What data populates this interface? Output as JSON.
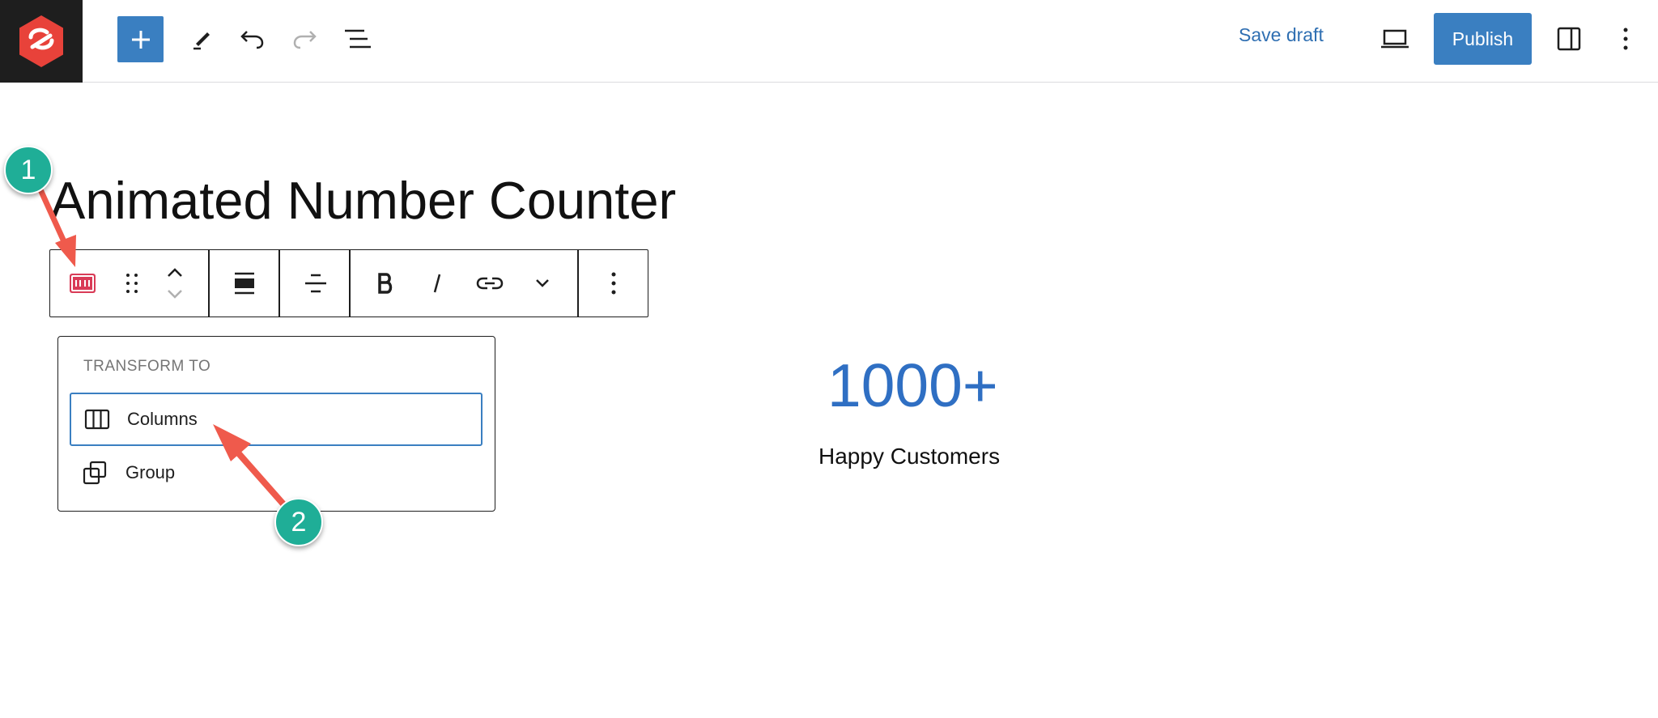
{
  "header": {
    "save_draft_label": "Save draft",
    "publish_label": "Publish",
    "accent_color": "#3a7fc1",
    "logo_color": "#e8423a"
  },
  "editor": {
    "title": "Animated Number Counter"
  },
  "block_toolbar": {
    "icons": [
      "counter-block-icon",
      "drag-handle-icon",
      "move-up-icon",
      "move-down-icon",
      "align-wide-icon",
      "align-center-icon",
      "bold-icon",
      "italic-icon",
      "link-icon",
      "chevron-down-icon",
      "more-options-icon"
    ]
  },
  "transform_panel": {
    "heading": "TRANSFORM TO",
    "items": [
      {
        "label": "Columns",
        "icon": "columns-icon",
        "selected": true
      },
      {
        "label": "Group",
        "icon": "group-icon",
        "selected": false
      }
    ]
  },
  "counter": {
    "number": "1000+",
    "label": "Happy Customers",
    "number_color": "#2f6fc3"
  },
  "annotations": [
    {
      "label": "1"
    },
    {
      "label": "2"
    }
  ]
}
